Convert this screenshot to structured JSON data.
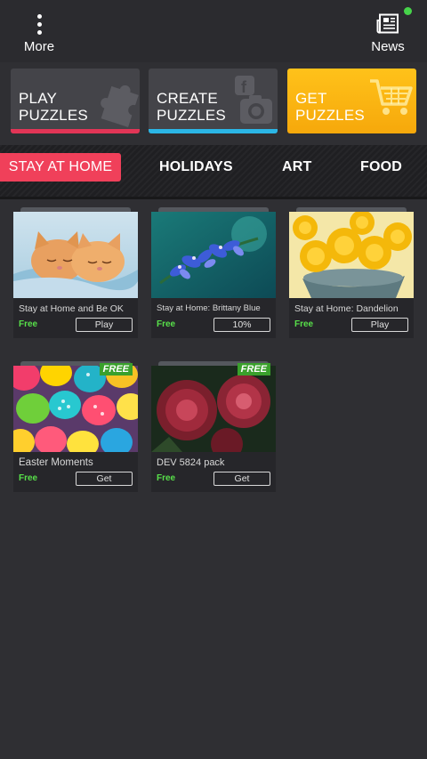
{
  "top": {
    "more_label": "More",
    "news_label": "News",
    "news_indicator_color": "#46d34a"
  },
  "actions": [
    {
      "line1": "PLAY",
      "line2": "PUZZLES",
      "icon": "puzzle-icon",
      "accent": "#e23556"
    },
    {
      "line1": "CREATE",
      "line2": "PUZZLES",
      "icon": "camera-facebook-icon",
      "accent": "#2bb6e6"
    },
    {
      "line1": "GET",
      "line2": "PUZZLES",
      "icon": "cart-icon",
      "accent": "#f6a80b"
    }
  ],
  "tabs": [
    "STAY AT HOME",
    "HOLIDAYS",
    "ART",
    "FOOD"
  ],
  "cards": [
    {
      "title": "Stay at Home and Be OK",
      "price": "Free",
      "action": "Play",
      "image": "sleeping-kittens"
    },
    {
      "title": "Stay at Home: Brittany Blue",
      "price": "Free",
      "action": "10%",
      "image": "blue-flowers"
    },
    {
      "title": "Stay at Home: Dandelion",
      "price": "Free",
      "action": "Play",
      "image": "yellow-dandelions"
    },
    {
      "title": "Easter Moments",
      "price": "Free",
      "action": "Get",
      "image": "easter-eggs",
      "badge": "FREE"
    },
    {
      "title": "DEV 5824 pack",
      "price": "Free",
      "action": "Get",
      "image": "red-chrysanthemum",
      "badge": "FREE"
    }
  ]
}
